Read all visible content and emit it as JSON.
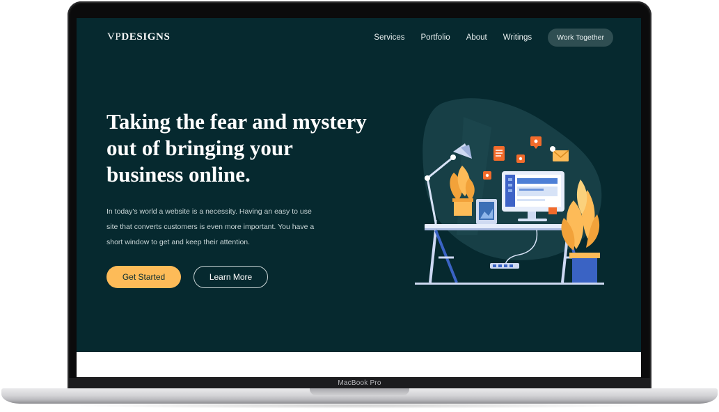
{
  "device": {
    "model_label": "MacBook Pro"
  },
  "site": {
    "logo": {
      "prefix": "VP",
      "suffix": "DESIGNS"
    },
    "nav": {
      "links": [
        "Services",
        "Portfolio",
        "About",
        "Writings"
      ],
      "cta": "Work Together"
    },
    "hero": {
      "headline": "Taking the fear and mystery out of bringing your business online.",
      "body": "In today's world a website is a necessity. Having an easy to use site that converts customers is even more important. You have a short window to get and keep their attention.",
      "primary_button": "Get Started",
      "secondary_button": "Learn More"
    },
    "colors": {
      "background": "#06292f",
      "accent": "#fdbb58",
      "nav_pill": "#2f4e52",
      "text": "#ffffff"
    }
  },
  "illustration": {
    "description_icons": [
      "desk-lamp-icon",
      "potted-plant-icon",
      "monitor-icon",
      "tablet-icon",
      "document-icon",
      "mail-icon",
      "notification-icon",
      "power-strip-icon"
    ]
  }
}
